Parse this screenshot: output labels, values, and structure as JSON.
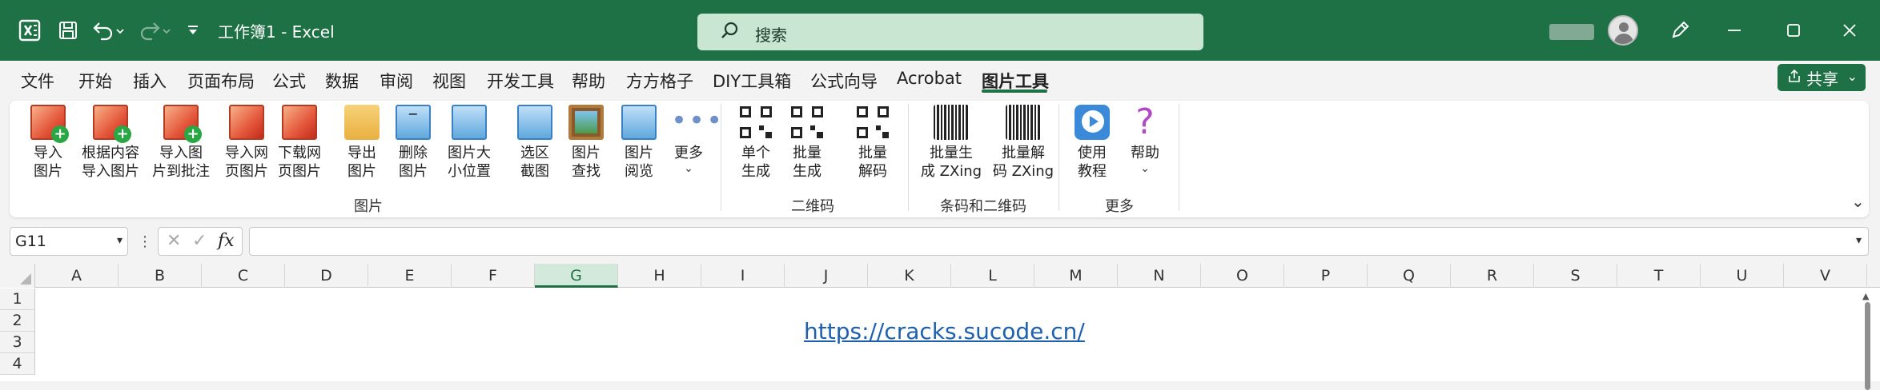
{
  "titlebar": {
    "doc_title": "工作簿1  -  Excel",
    "search_placeholder": "搜索"
  },
  "menu": {
    "tabs": [
      "文件",
      "开始",
      "插入",
      "页面布局",
      "公式",
      "数据",
      "审阅",
      "视图",
      "开发工具",
      "帮助",
      "方方格子",
      "DIY工具箱",
      "公式向导",
      "Acrobat",
      "图片工具"
    ],
    "active_tab": "图片工具",
    "share_label": "共享"
  },
  "ribbon": {
    "groups": {
      "picture": "图片",
      "qrcode": "二维码",
      "barcode": "条码和二维码",
      "more": "更多"
    },
    "buttons": {
      "import_picture": "导入\n图片",
      "import_by_content": "根据内容\n导入图片",
      "import_to_comment": "导入图\n片到批注",
      "import_web_picture": "导入网\n页图片",
      "download_web_picture": "下载网\n页图片",
      "export_picture": "导出\n图片",
      "delete_picture": "删除\n图片",
      "picture_size_position": "图片大\n小位置",
      "select_screenshot": "选区\n截图",
      "picture_search": "图片\n查找",
      "picture_browse": "图片\n阅览",
      "more": "更多",
      "single_generate": "单个\n生成",
      "batch_generate": "批量\n生成",
      "batch_decode": "批量\n解码",
      "batch_generate_zxing": "批量生\n成 ZXing",
      "batch_decode_zxing": "批量解\n码 ZXing",
      "tutorial": "使用\n教程",
      "help": "帮助"
    }
  },
  "formula_bar": {
    "name_box": "G11",
    "fx_label": "fx",
    "formula": ""
  },
  "sheet": {
    "columns": [
      "A",
      "B",
      "C",
      "D",
      "E",
      "F",
      "G",
      "H",
      "I",
      "J",
      "K",
      "L",
      "M",
      "N",
      "O",
      "P",
      "Q",
      "R",
      "S",
      "T",
      "U",
      "V"
    ],
    "selected_column": "G",
    "rows": [
      "1",
      "2",
      "3",
      "4"
    ],
    "link_text": "https://cracks.sucode.cn/"
  },
  "colors": {
    "excel_green": "#1e7145",
    "link_blue": "#1f5fb0"
  }
}
